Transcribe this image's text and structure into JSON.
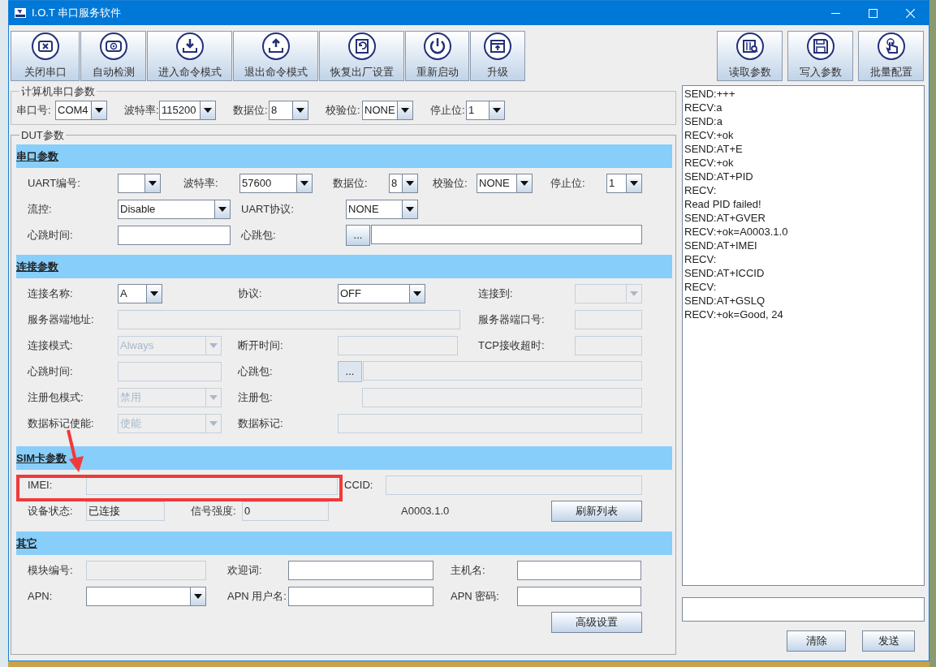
{
  "window": {
    "title": "I.O.T 串口服务软件"
  },
  "toolbar": {
    "left": [
      {
        "label": "关闭串口"
      },
      {
        "label": "自动检测"
      },
      {
        "label": "进入命令模式"
      },
      {
        "label": "退出命令模式"
      },
      {
        "label": "恢复出厂设置"
      },
      {
        "label": "重新启动"
      },
      {
        "label": "升级"
      }
    ],
    "right": [
      {
        "label": "读取参数"
      },
      {
        "label": "写入参数"
      },
      {
        "label": "批量配置"
      }
    ]
  },
  "pc_serial": {
    "title": "计算机串口参数",
    "fields": [
      {
        "label": "串口号:",
        "value": "COM4"
      },
      {
        "label": "波特率:",
        "value": "115200"
      },
      {
        "label": "数据位:",
        "value": "8"
      },
      {
        "label": "校验位:",
        "value": "NONE"
      },
      {
        "label": "停止位:",
        "value": "1"
      }
    ]
  },
  "dut": {
    "title": "DUT参数",
    "sections": [
      {
        "title": "串口参数",
        "rows": [
          {
            "fields": [
              {
                "kind": "combo",
                "label": "UART编号:",
                "disabled": false
              },
              {
                "kind": "combo",
                "label": "波特率:",
                "value": "57600",
                "disabled": false
              },
              {
                "kind": "combo",
                "label": "数据位:",
                "value": "8",
                "disabled": false
              },
              {
                "kind": "combo",
                "label": "校验位:",
                "value": "NONE",
                "disabled": false
              },
              {
                "kind": "combo",
                "label": "停止位:",
                "value": "1",
                "disabled": false
              }
            ]
          },
          {
            "fields": [
              {
                "kind": "combo",
                "label": "流控:",
                "value": "Disable",
                "disabled": false
              },
              {
                "kind": "combo",
                "label": "UART协议:",
                "value": "NONE",
                "disabled": false
              }
            ]
          },
          {
            "fields": [
              {
                "kind": "text",
                "label": "心跳时间:",
                "disabled": false
              },
              {
                "kind": "picker",
                "label": "心跳包:",
                "button": "...",
                "disabled": false
              }
            ]
          }
        ]
      },
      {
        "title": "连接参数",
        "rows": [
          {
            "fields": [
              {
                "kind": "combo",
                "label": "连接名称:",
                "value": "A",
                "disabled": false
              },
              {
                "kind": "combo",
                "label": "协议:",
                "value": "OFF",
                "disabled": false
              },
              {
                "kind": "combo",
                "label": "连接到:",
                "disabled": true
              }
            ]
          },
          {
            "fields": [
              {
                "kind": "text",
                "label": "服务器端地址:",
                "disabled": true
              },
              {
                "kind": "text",
                "label": "服务器端口号:",
                "disabled": true
              }
            ]
          },
          {
            "fields": [
              {
                "kind": "combo",
                "label": "连接模式:",
                "value": "Always",
                "disabled": true
              },
              {
                "kind": "text",
                "label": "断开时间:",
                "disabled": true
              },
              {
                "kind": "text",
                "label": "TCP接收超时:",
                "disabled": true
              }
            ]
          },
          {
            "fields": [
              {
                "kind": "text",
                "label": "心跳时间:",
                "disabled": true
              },
              {
                "kind": "picker",
                "label": "心跳包:",
                "button": "...",
                "disabled": true
              }
            ]
          },
          {
            "fields": [
              {
                "kind": "combo",
                "label": "注册包模式:",
                "value": "禁用",
                "disabled": true
              },
              {
                "kind": "text",
                "label": "注册包:",
                "disabled": true
              }
            ]
          },
          {
            "fields": [
              {
                "kind": "combo",
                "label": "数据标记使能:",
                "value": "使能",
                "disabled": true
              },
              {
                "kind": "text",
                "label": "数据标记:",
                "disabled": true
              }
            ]
          }
        ]
      },
      {
        "title": "SIM卡参数",
        "rows": [
          {
            "fields": [
              {
                "kind": "text",
                "label": "IMEI:",
                "disabled": true
              },
              {
                "kind": "text",
                "label": "CCID:",
                "disabled": true
              }
            ]
          },
          {
            "fields": [
              {
                "kind": "text",
                "label": "设备状态:",
                "value": "已连接",
                "disabled": true
              },
              {
                "kind": "text",
                "label": "信号强度:",
                "value": "0",
                "disabled": true
              },
              {
                "kind": "plain",
                "value": "A0003.1.0"
              },
              {
                "kind": "button",
                "value": "刷新列表"
              }
            ]
          }
        ]
      },
      {
        "title": "其它",
        "rows": [
          {
            "fields": [
              {
                "kind": "text",
                "label": "模块编号:",
                "disabled": true
              },
              {
                "kind": "text",
                "label": "欢迎词:",
                "disabled": false
              },
              {
                "kind": "text",
                "label": "主机名:",
                "disabled": false
              }
            ]
          },
          {
            "fields": [
              {
                "kind": "combo",
                "label": "APN:",
                "disabled": false
              },
              {
                "kind": "text",
                "label": "APN 用户名:",
                "disabled": false
              },
              {
                "kind": "text",
                "label": "APN 密码:",
                "disabled": false
              }
            ]
          },
          {
            "fields": [
              {
                "kind": "button",
                "value": "高级设置"
              }
            ]
          }
        ]
      }
    ]
  },
  "log": {
    "lines": [
      "SEND:+++",
      "RECV:a",
      "SEND:a",
      "RECV:+ok",
      "SEND:AT+E",
      "RECV:+ok",
      "SEND:AT+PID",
      "RECV:",
      "Read PID failed!",
      "SEND:AT+GVER",
      "RECV:+ok=A0003.1.0",
      "SEND:AT+IMEI",
      "RECV:",
      "SEND:AT+ICCID",
      "RECV:",
      "SEND:AT+GSLQ",
      "RECV:+ok=Good, 24"
    ]
  },
  "buttons": [
    "清除",
    "发送"
  ]
}
